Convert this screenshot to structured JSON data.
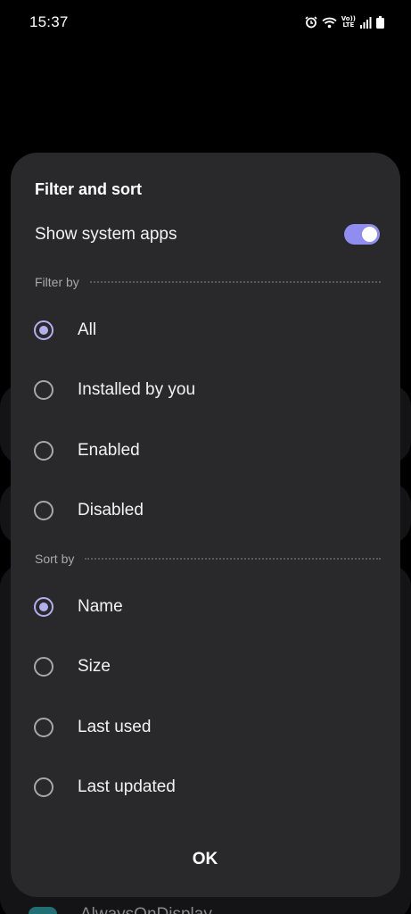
{
  "status_bar": {
    "time": "15:37",
    "icons": [
      "alarm-icon",
      "wifi-icon",
      "volte-icon",
      "signal-icon",
      "battery-icon"
    ],
    "volte_top": "Vo))",
    "volte_bottom": "LTE"
  },
  "background": {
    "app_label": "AlwaysOnDisplay"
  },
  "dialog": {
    "title": "Filter and sort",
    "show_system_apps": {
      "label": "Show system apps",
      "enabled": true
    },
    "filter_by": {
      "label": "Filter by",
      "selected": "All",
      "options": [
        {
          "label": "All",
          "selected": true
        },
        {
          "label": "Installed by you",
          "selected": false
        },
        {
          "label": "Enabled",
          "selected": false
        },
        {
          "label": "Disabled",
          "selected": false
        }
      ]
    },
    "sort_by": {
      "label": "Sort by",
      "selected": "Name",
      "options": [
        {
          "label": "Name",
          "selected": true
        },
        {
          "label": "Size",
          "selected": false
        },
        {
          "label": "Last used",
          "selected": false
        },
        {
          "label": "Last updated",
          "selected": false
        }
      ]
    },
    "ok_label": "OK"
  },
  "colors": {
    "sheet_bg": "#29292b",
    "accent": "#b3afee",
    "toggle_track": "#8f8df0"
  }
}
